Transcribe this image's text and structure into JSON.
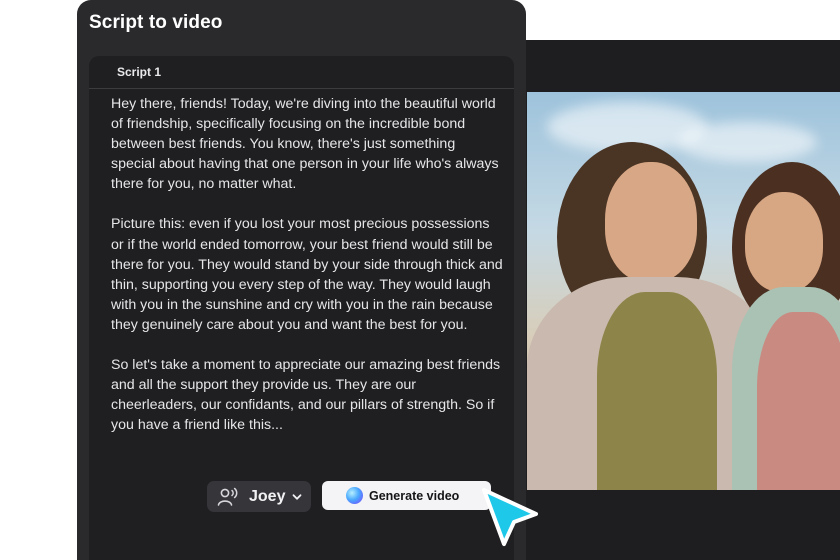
{
  "panel": {
    "title": "Script to video",
    "tab_label": "Script 1"
  },
  "script": {
    "paragraphs": [
      "Hey there, friends! Today, we're diving into the beautiful world of friendship, specifically focusing on the incredible bond between best friends. You know, there's just something special about having that one person in your life who's always there for you, no matter what.",
      "Picture this: even if you lost your most precious possessions or if the world ended tomorrow, your best friend would still be there for you. They would stand by your side through thick and thin, supporting you every step of the way. They would laugh with you in the sunshine and cry with you in the rain because they genuinely care about you and want the best for you.",
      "So let's take a moment to appreciate our amazing best friends and all the support they provide us. They are our cheerleaders, our confidants, and our pillars of strength. So if you have a friend like this..."
    ]
  },
  "controls": {
    "voice_name": "Joey",
    "voice_icon": "person-voice-icon",
    "dropdown_icon": "chevron-down-icon",
    "generate_label": "Generate video",
    "generate_icon": "ai-orb-icon"
  },
  "colors": {
    "panel_bg": "#2a2a2d",
    "editor_bg": "#1f1f22",
    "cursor": "#1ec8e8"
  }
}
